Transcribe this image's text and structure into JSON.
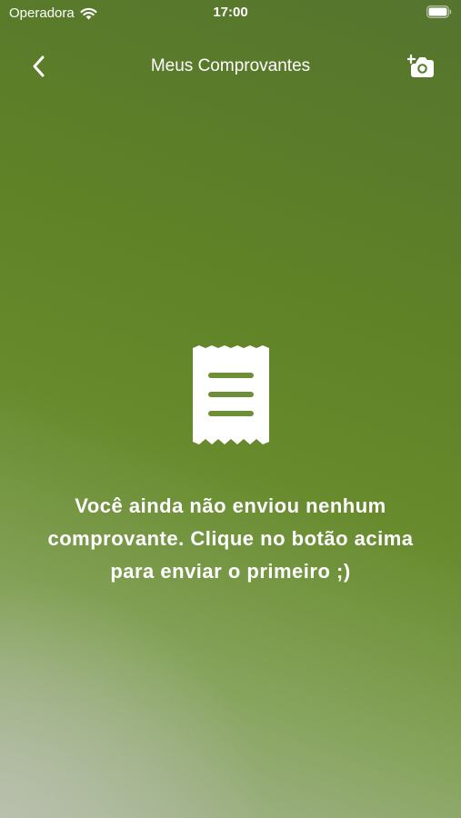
{
  "status_bar": {
    "carrier": "Operadora",
    "time": "17:00"
  },
  "nav": {
    "title": "Meus Comprovantes",
    "back_icon": "chevron-left-icon",
    "action_icon": "camera-add-icon"
  },
  "empty_state": {
    "icon": "receipt-icon",
    "message": "Você ainda não enviou nenhum comprovante. Clique no botão acima para enviar o primeiro ;)"
  },
  "colors": {
    "background_top": "#55742e",
    "background_mid": "#678a2c",
    "background_bottom_left": "#b3bba8",
    "foreground": "#ffffff"
  }
}
